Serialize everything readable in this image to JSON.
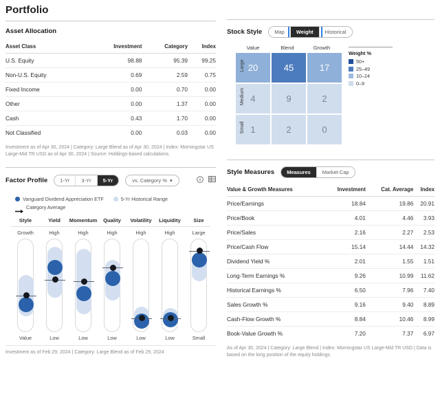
{
  "page": {
    "title": "Portfolio"
  },
  "asset_allocation": {
    "title": "Asset Allocation",
    "columns": [
      "Asset Class",
      "Investment",
      "Category",
      "Index"
    ],
    "rows": [
      {
        "label": "U.S. Equity",
        "investment": "98.88",
        "category": "95.39",
        "index": "99.25"
      },
      {
        "label": "Non-U.S. Equity",
        "investment": "0.69",
        "category": "2.59",
        "index": "0.75"
      },
      {
        "label": "Fixed Income",
        "investment": "0.00",
        "category": "0.70",
        "index": "0.00"
      },
      {
        "label": "Other",
        "investment": "0.00",
        "category": "1.37",
        "index": "0.00"
      },
      {
        "label": "Cash",
        "investment": "0.43",
        "category": "1.70",
        "index": "0.00"
      },
      {
        "label": "Not Classified",
        "investment": "0.00",
        "category": "0.03",
        "index": "0.00"
      }
    ],
    "footnote": "Investment as of Apr 30, 2024 | Category: Large Blend as of Apr 30, 2024 | Index: Morningstar US Large-Mid TR USD as of Apr 30, 2024 | Source: Holdings-based calculations."
  },
  "stock_style": {
    "title": "Stock Style",
    "tabs": [
      {
        "label": "Map",
        "active": false
      },
      {
        "label": "Weight",
        "active": true
      },
      {
        "label": "Historical",
        "active": false
      }
    ],
    "col_labels": [
      "Value",
      "Blend",
      "Growth"
    ],
    "row_labels": [
      "Large",
      "Medium",
      "Small"
    ],
    "chart_data": {
      "type": "heatmap",
      "title": "Stock Style — Weight %",
      "x": [
        "Value",
        "Blend",
        "Growth"
      ],
      "y": [
        "Large",
        "Medium",
        "Small"
      ],
      "values": [
        [
          20,
          45,
          17
        ],
        [
          4,
          9,
          2
        ],
        [
          1,
          2,
          0
        ]
      ],
      "legend_title": "Weight %",
      "legend": [
        {
          "label": "50+",
          "color": "#1f4e99"
        },
        {
          "label": "25–49",
          "color": "#4d7cbe"
        },
        {
          "label": "10–24",
          "color": "#9fbbdf"
        },
        {
          "label": "0–9",
          "color": "#cfdded"
        }
      ]
    }
  },
  "factor_profile": {
    "title": "Factor Profile",
    "period_tabs": [
      {
        "label": "1-Yr",
        "active": false
      },
      {
        "label": "3-Yr",
        "active": false
      },
      {
        "label": "5-Yr",
        "active": true
      }
    ],
    "compare_dropdown": "vs. Category %",
    "icons": {
      "info": "info-icon",
      "grid": "table-view-icon"
    },
    "legend": [
      {
        "label": "Vanguard Dividend Appreciation ETF",
        "marker": "dot",
        "color": "#2b62ab"
      },
      {
        "label": "5-Yr Historical Range",
        "marker": "dot",
        "color": "#cfdded"
      },
      {
        "label": "Category Average",
        "marker": "arrow",
        "color": "#15181d"
      }
    ],
    "chart_data": {
      "type": "scatter",
      "title": "Factor Profile (5-Yr, vs. Category %)",
      "categories": [
        "Style",
        "Yield",
        "Momentum",
        "Quality",
        "Volatility",
        "Liquidity",
        "Size"
      ],
      "top_labels": [
        "Growth",
        "High",
        "High",
        "High",
        "High",
        "High",
        "Large"
      ],
      "bottom_labels": [
        "Value",
        "Low",
        "Low",
        "Low",
        "Low",
        "Low",
        "Small"
      ],
      "series": [
        {
          "name": "Vanguard Dividend Appreciation ETF",
          "values": [
            30,
            70,
            42,
            58,
            13,
            14,
            78
          ]
        },
        {
          "name": "Category Average",
          "values": [
            40,
            57,
            55,
            70,
            16,
            16,
            88
          ]
        }
      ],
      "ranges": [
        {
          "low": 18,
          "high": 62
        },
        {
          "low": 38,
          "high": 92
        },
        {
          "low": 20,
          "high": 90
        },
        {
          "low": 35,
          "high": 78
        },
        {
          "low": 6,
          "high": 28
        },
        {
          "low": 7,
          "high": 27
        },
        {
          "low": 55,
          "high": 86
        }
      ]
    },
    "footnote": "Investment as of Feb 29, 2024 | Category: Large Blend as of Feb 29, 2024"
  },
  "style_measures": {
    "title": "Style Measures",
    "tabs": [
      {
        "label": "Measures",
        "active": true
      },
      {
        "label": "Market Cap",
        "active": false
      }
    ],
    "columns": [
      "Value & Growth Measures",
      "Investment",
      "Cat. Average",
      "Index"
    ],
    "rows": [
      {
        "label": "Price/Earnings",
        "investment": "18.84",
        "cat_average": "19.86",
        "index": "20.91"
      },
      {
        "label": "Price/Book",
        "investment": "4.01",
        "cat_average": "4.46",
        "index": "3.93"
      },
      {
        "label": "Price/Sales",
        "investment": "2.16",
        "cat_average": "2.27",
        "index": "2.53"
      },
      {
        "label": "Price/Cash Flow",
        "investment": "15.14",
        "cat_average": "14.44",
        "index": "14.32"
      },
      {
        "label": "Dividend Yield %",
        "investment": "2.01",
        "cat_average": "1.55",
        "index": "1.51"
      },
      {
        "label": "Long-Term Earnings %",
        "investment": "9.26",
        "cat_average": "10.99",
        "index": "11.62"
      },
      {
        "label": "Historical Earnings %",
        "investment": "6.50",
        "cat_average": "7.96",
        "index": "7.40"
      },
      {
        "label": "Sales Growth %",
        "investment": "9.16",
        "cat_average": "9.40",
        "index": "8.89"
      },
      {
        "label": "Cash-Flow Growth %",
        "investment": "8.84",
        "cat_average": "10.46",
        "index": "8.99"
      },
      {
        "label": "Book-Value Growth %",
        "investment": "7.20",
        "cat_average": "7.37",
        "index": "6.97"
      }
    ],
    "footnote": "As of Apr 30, 2024 | Category: Large Blend | Index: Morningstar US Large-Mid TR USD | Data is based on the long position of the equity holdings."
  }
}
